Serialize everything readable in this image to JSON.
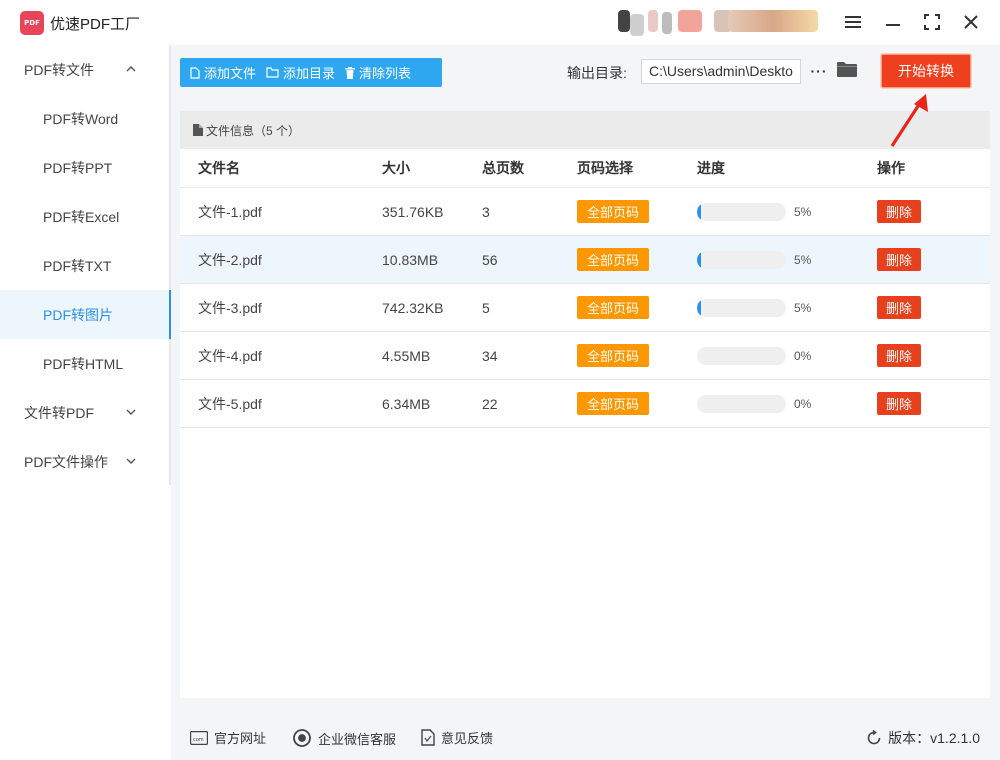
{
  "app": {
    "title": "优速PDF工厂",
    "logo_text": "PDF"
  },
  "sidebar": {
    "groups": [
      {
        "label": "PDF转文件",
        "expanded": true,
        "items": [
          {
            "label": "PDF转Word"
          },
          {
            "label": "PDF转PPT"
          },
          {
            "label": "PDF转Excel"
          },
          {
            "label": "PDF转TXT"
          },
          {
            "label": "PDF转图片",
            "active": true
          },
          {
            "label": "PDF转HTML"
          }
        ]
      },
      {
        "label": "文件转PDF",
        "expanded": false
      },
      {
        "label": "PDF文件操作",
        "expanded": false
      }
    ]
  },
  "toolbar": {
    "add_file": "添加文件",
    "add_dir": "添加目录",
    "clear_list": "清除列表",
    "output_label": "输出目录:",
    "output_path": "C:\\Users\\admin\\Deskto",
    "more": "···",
    "start": "开始转换"
  },
  "panel": {
    "header": "文件信息（5 个）",
    "columns": [
      "文件名",
      "大小",
      "总页数",
      "页码选择",
      "进度",
      "操作"
    ],
    "rows": [
      {
        "name": "文件-1.pdf",
        "size": "351.76KB",
        "pages": "3",
        "page_sel": "全部页码",
        "progress": 5,
        "progress_text": "5%",
        "action": "删除"
      },
      {
        "name": "文件-2.pdf",
        "size": "10.83MB",
        "pages": "56",
        "page_sel": "全部页码",
        "progress": 5,
        "progress_text": "5%",
        "action": "删除"
      },
      {
        "name": "文件-3.pdf",
        "size": "742.32KB",
        "pages": "5",
        "page_sel": "全部页码",
        "progress": 5,
        "progress_text": "5%",
        "action": "删除"
      },
      {
        "name": "文件-4.pdf",
        "size": "4.55MB",
        "pages": "34",
        "page_sel": "全部页码",
        "progress": 0,
        "progress_text": "0%",
        "action": "删除"
      },
      {
        "name": "文件-5.pdf",
        "size": "6.34MB",
        "pages": "22",
        "page_sel": "全部页码",
        "progress": 0,
        "progress_text": "0%",
        "action": "删除"
      }
    ]
  },
  "footer": {
    "website": "官方网址",
    "wechat": "企业微信客服",
    "feedback": "意见反馈",
    "version": "版本：v1.2.1.0"
  },
  "colors": {
    "accent": "#2b91e6",
    "toolbar_bg": "#2fa7f0",
    "start_btn": "#ee3f1f",
    "page_btn": "#ff9800",
    "delete_btn": "#e6401d"
  }
}
